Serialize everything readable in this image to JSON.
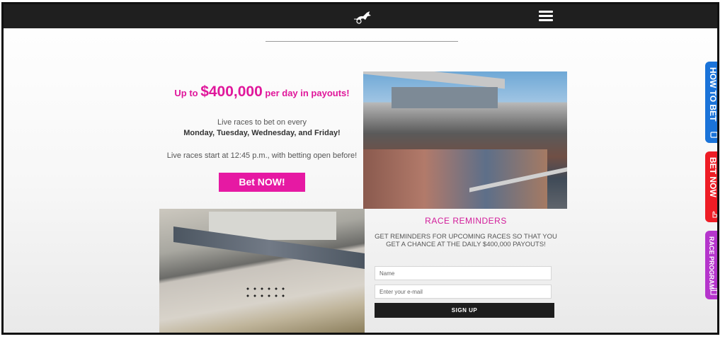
{
  "header": {
    "logo_icon": "harness-racing-horse-logo-icon",
    "menu_icon": "hamburger-menu-icon"
  },
  "hero": {
    "payout_prefix": "Up to ",
    "payout_amount": "$400,000",
    "payout_suffix": " per day in payouts!",
    "live_line": "Live races to bet on every",
    "days_line": "Monday, Tuesday, Wednesday, and Friday!",
    "start_line": "Live races start at 12:45 p.m., with betting open before!",
    "bet_button": "Bet NOW!"
  },
  "reminders": {
    "title": "RACE REMINDERS",
    "text": "GET REMINDERS FOR UPCOMING RACES SO THAT YOU GET A CHANCE AT THE DAILY $400,000 PAYOUTS!",
    "name_placeholder": "Name",
    "email_placeholder": "Enter your e-mail",
    "signup_button": "SIGN UP"
  },
  "side_tabs": {
    "how_to_bet": "HOW TO BET",
    "bet_now": "BET NOW",
    "race_program": "RACE PROGRAM"
  },
  "colors": {
    "accent_pink": "#e619a3",
    "how_to_bet_blue": "#1a73d9",
    "bet_now_red": "#ee1c25",
    "race_program_purple": "#b535cc",
    "topbar": "#1f1f1f"
  }
}
